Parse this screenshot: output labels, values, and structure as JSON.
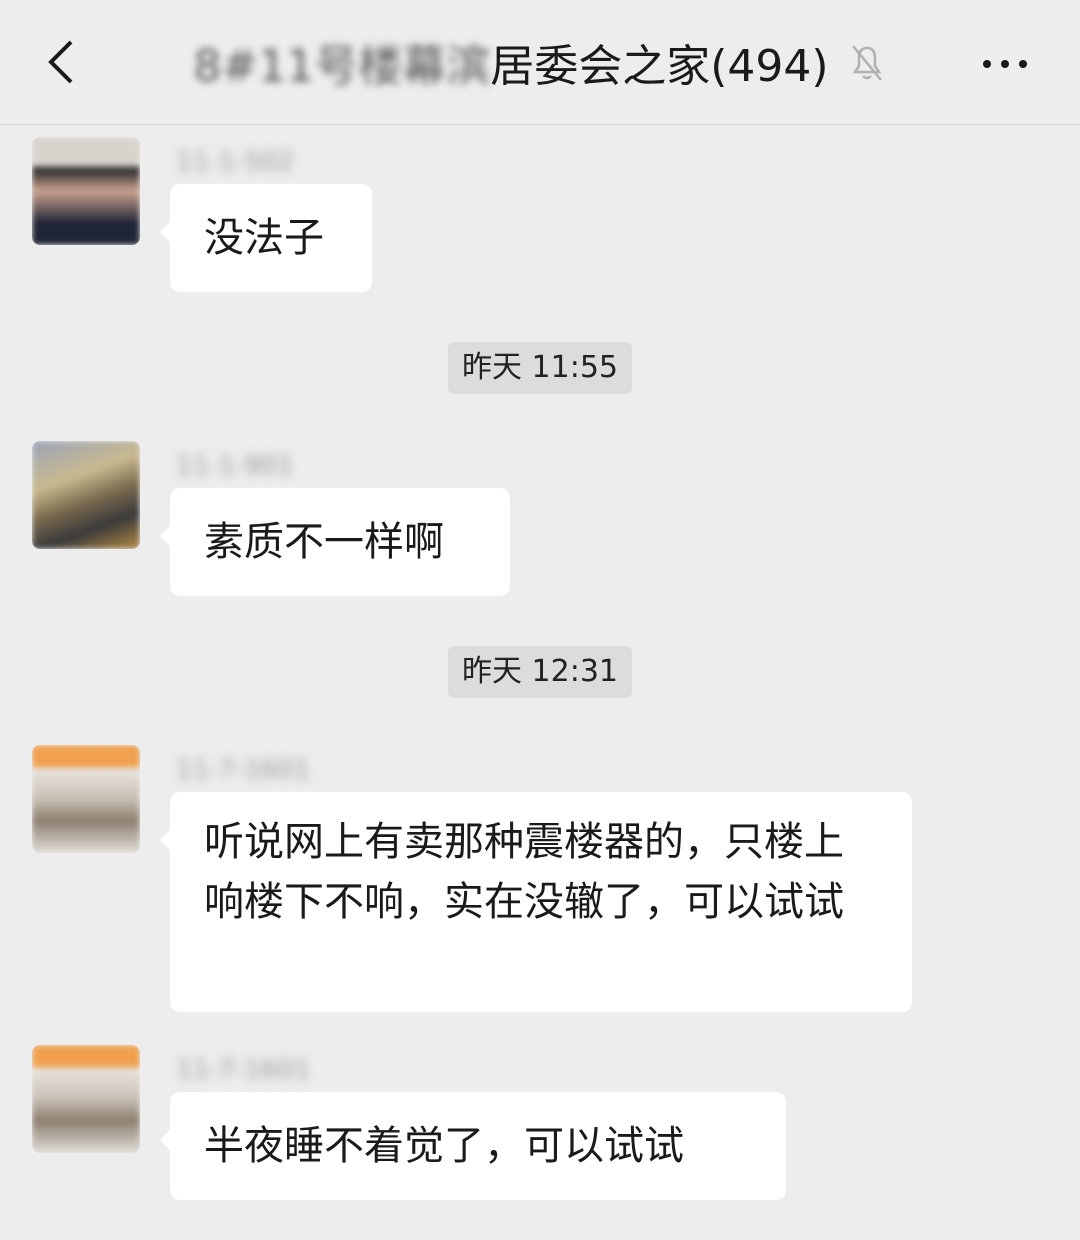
{
  "header": {
    "title_blurred_prefix": "8#11号楼",
    "title_blurred_mid": "幕滨",
    "title_suffix": "居委会之家(494)",
    "back_icon": "chevron-left-icon",
    "mute_icon": "bell-off-icon",
    "more_icon": "more-dots-icon"
  },
  "messages": [
    {
      "sender": "11-1-502",
      "text": "没法子",
      "avatar_color": "#3b3e4a"
    },
    {
      "sender": "11-1-901",
      "text": "素质不一样啊",
      "avatar_color": "#8c8578"
    },
    {
      "sender": "11-7-1601",
      "text": "听说网上有卖那种震楼器的，只楼上响楼下不响，实在没辙了，可以试试",
      "avatar_color": "#e6a25a"
    },
    {
      "sender": "11-7-1601",
      "text": "半夜睡不着觉了，可以试试",
      "avatar_color": "#e6a25a"
    }
  ],
  "timestamps": [
    "昨天 11:55",
    "昨天 12:31"
  ]
}
